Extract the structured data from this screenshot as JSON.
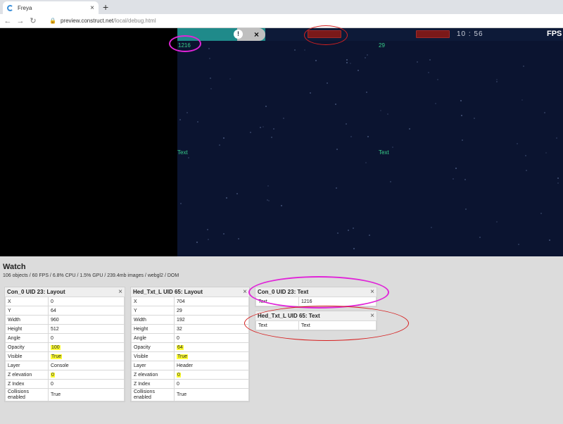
{
  "browser": {
    "tab_title": "Freya",
    "tab_close": "×",
    "new_tab": "+",
    "url_host": "preview.construct.net",
    "url_path": "/local/debug.html"
  },
  "game": {
    "counter": "1216",
    "timer": "10 : 56",
    "header_value": "29",
    "fps_label": "FPS",
    "fps_value": "60",
    "text_left": "Text",
    "text_right": "Text",
    "alert_glyph": "!",
    "close_glyph": "×"
  },
  "debug": {
    "title": "Watch",
    "stats": "106 objects / 60 FPS / 6.8% CPU / 1.5% GPU / 239.4mb images / webgl2 / DOM",
    "close_glyph": "×",
    "panels": [
      {
        "title": "Con_0 UID 23: Layout",
        "rows": [
          {
            "key": "X",
            "value": "0"
          },
          {
            "key": "Y",
            "value": "64"
          },
          {
            "key": "Width",
            "value": "960"
          },
          {
            "key": "Height",
            "value": "512"
          },
          {
            "key": "Angle",
            "value": "0"
          },
          {
            "key": "Opacity",
            "value": "100"
          },
          {
            "key": "Visible",
            "value": "True"
          },
          {
            "key": "Layer",
            "value": "Console"
          },
          {
            "key": "Z elevation",
            "value": "0"
          },
          {
            "key": "Z Index",
            "value": "0"
          },
          {
            "key": "Collisions enabled",
            "value": "True"
          }
        ]
      },
      {
        "title": "Hed_Txt_L UID 65: Layout",
        "rows": [
          {
            "key": "X",
            "value": "704"
          },
          {
            "key": "Y",
            "value": "29"
          },
          {
            "key": "Width",
            "value": "192"
          },
          {
            "key": "Height",
            "value": "32"
          },
          {
            "key": "Angle",
            "value": "0"
          },
          {
            "key": "Opacity",
            "value": "64"
          },
          {
            "key": "Visible",
            "value": "True"
          },
          {
            "key": "Layer",
            "value": "Header"
          },
          {
            "key": "Z elevation",
            "value": "0"
          },
          {
            "key": "Z Index",
            "value": "0"
          },
          {
            "key": "Collisions enabled",
            "value": "True"
          }
        ]
      },
      {
        "title": "Con_0 UID 23: Text",
        "rows": [
          {
            "key": "Text",
            "value": "1216"
          }
        ]
      },
      {
        "title": "Hed_Txt_L UID 65: Text",
        "rows": [
          {
            "key": "Text",
            "value": "Text"
          }
        ]
      }
    ]
  },
  "colors": {
    "canvas_bg": "#0b1430",
    "hud_teal": "#1f8a8a",
    "hud_red": "#7a1919",
    "game_text": "#38d08a",
    "highlight": "#ffff33",
    "annotation_magenta": "#e024d8",
    "annotation_red": "#d62020"
  }
}
